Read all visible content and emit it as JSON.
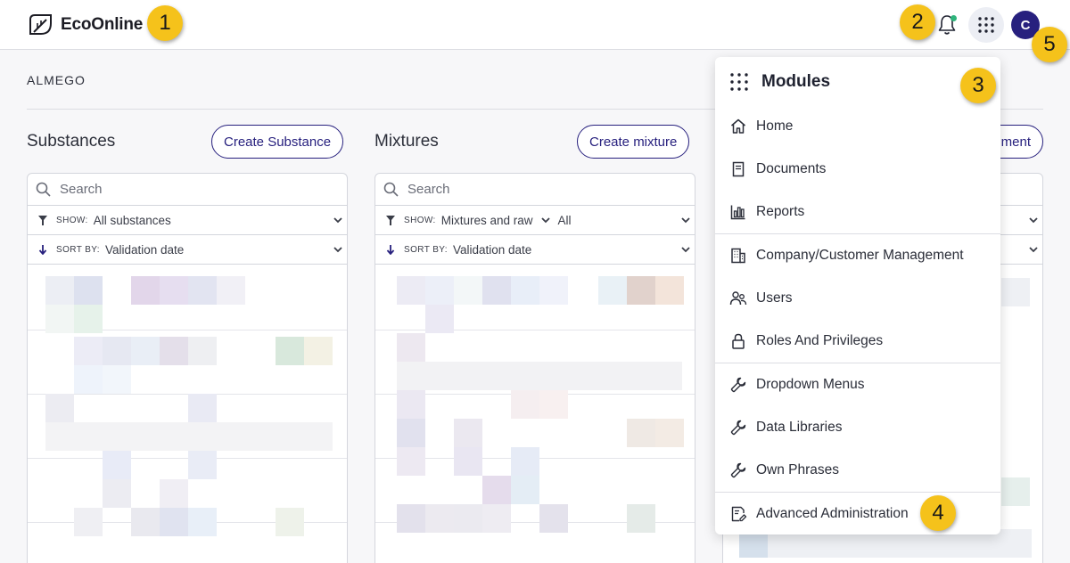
{
  "app": {
    "name": "EcoOnline"
  },
  "header": {
    "avatar_initial": "C"
  },
  "org_name": "ALMEGO",
  "columns": [
    {
      "title": "Substances",
      "create_label": "Create Substance",
      "search_placeholder": "Search",
      "filter": {
        "label": "SHOW:",
        "value": "All substances"
      },
      "sort": {
        "label": "SORT BY:",
        "value": "Validation date"
      }
    },
    {
      "title": "Mixtures",
      "create_label": "Create mixture",
      "search_placeholder": "Search",
      "filter": {
        "label": "SHOW:",
        "value": "Mixtures and raw",
        "value2": "All"
      },
      "sort": {
        "label": "SORT BY:",
        "value": "Validation date"
      }
    },
    {
      "create_label_partial": "ment"
    }
  ],
  "modules_menu": {
    "title": "Modules",
    "items": [
      {
        "label": "Home",
        "icon": "home-icon"
      },
      {
        "label": "Documents",
        "icon": "document-icon"
      },
      {
        "label": "Reports",
        "icon": "bar-chart-icon"
      },
      {
        "label": "Company/Customer Management",
        "icon": "building-icon"
      },
      {
        "label": "Users",
        "icon": "users-icon"
      },
      {
        "label": "Roles And Privileges",
        "icon": "lock-icon"
      },
      {
        "label": "Dropdown Menus",
        "icon": "wrench-icon"
      },
      {
        "label": "Data Libraries",
        "icon": "wrench-icon"
      },
      {
        "label": "Own Phrases",
        "icon": "wrench-icon"
      },
      {
        "label": "Advanced Administration",
        "icon": "admin-document-icon"
      }
    ]
  },
  "callouts": [
    "1",
    "2",
    "3",
    "4",
    "5"
  ],
  "colors": {
    "brand": "#27207e",
    "badge": "#f5c21b",
    "notification": "#2fb47c"
  }
}
